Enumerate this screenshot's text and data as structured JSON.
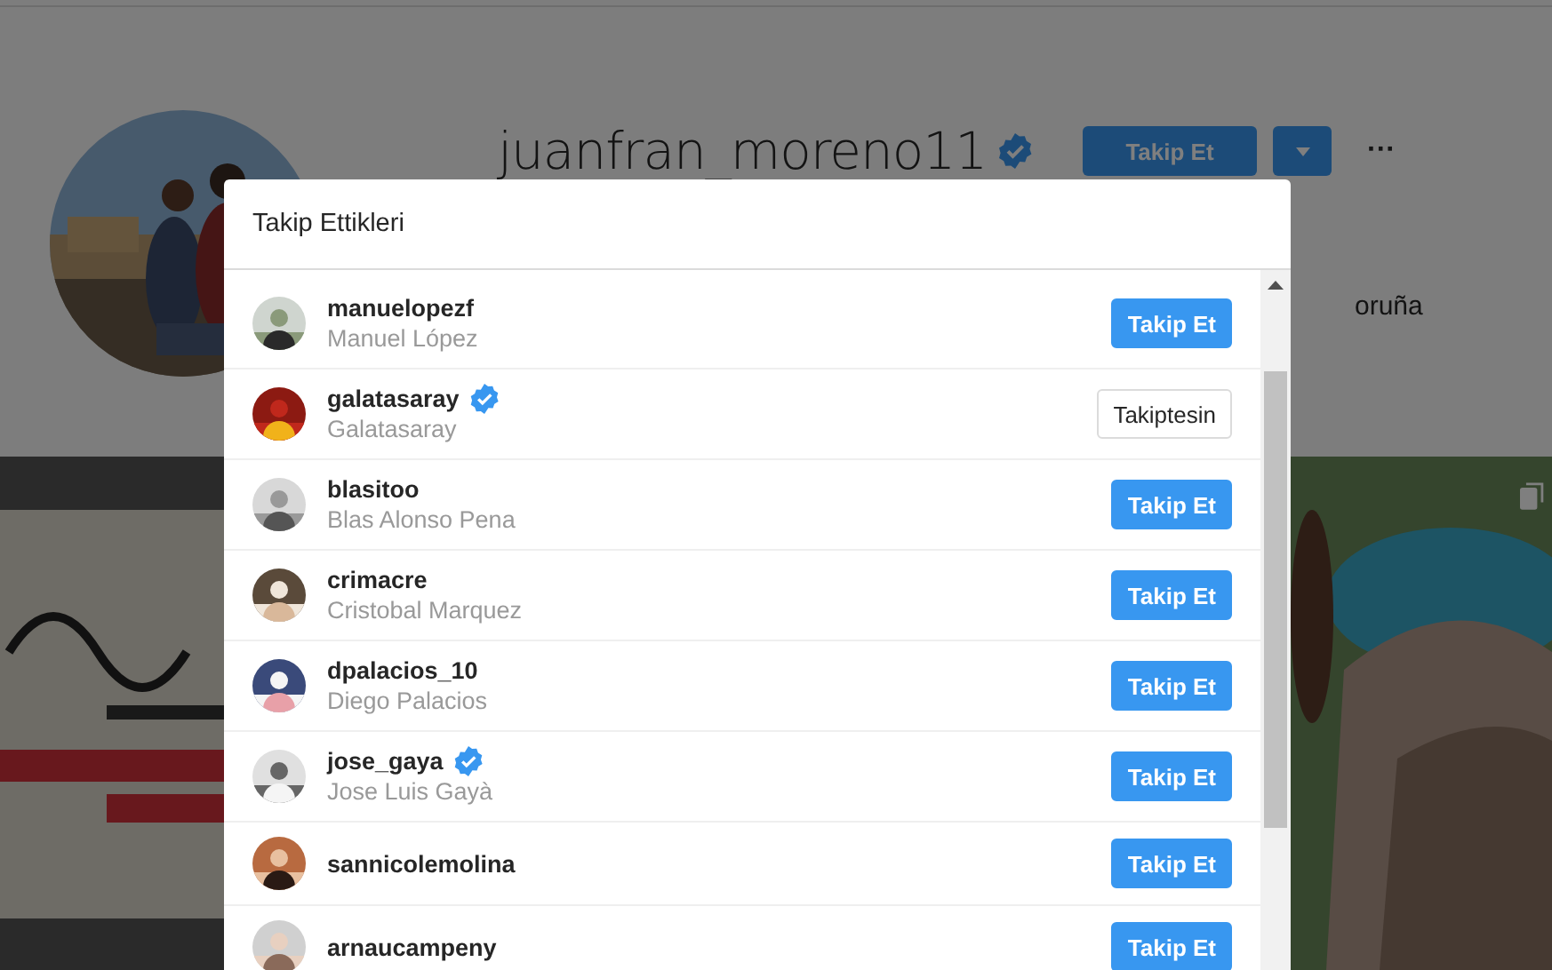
{
  "profile": {
    "username": "juanfran_moreno11",
    "verified": true,
    "follow_button": "Takip Et",
    "more": "···",
    "bio_fragment": "oruña"
  },
  "modal": {
    "title": "Takip Ettikleri",
    "users": [
      {
        "username": "manuelopezf",
        "full_name": "Manuel López",
        "verified": false,
        "button": "Takip Et",
        "following": false
      },
      {
        "username": "galatasaray",
        "full_name": "Galatasaray",
        "verified": true,
        "button": "Takiptesin",
        "following": true
      },
      {
        "username": "blasitoo",
        "full_name": "Blas Alonso Pena",
        "verified": false,
        "button": "Takip Et",
        "following": false
      },
      {
        "username": "crimacre",
        "full_name": "Cristobal Marquez",
        "verified": false,
        "button": "Takip Et",
        "following": false
      },
      {
        "username": "dpalacios_10",
        "full_name": "Diego Palacios",
        "verified": false,
        "button": "Takip Et",
        "following": false
      },
      {
        "username": "jose_gaya",
        "full_name": "Jose Luis Gayà",
        "verified": true,
        "button": "Takip Et",
        "following": false
      },
      {
        "username": "sannicolemolina",
        "verified": false,
        "button": "Takip Et",
        "following": false
      },
      {
        "username": "arnaucampeny",
        "verified": false,
        "button": "Takip Et",
        "following": false
      }
    ]
  }
}
